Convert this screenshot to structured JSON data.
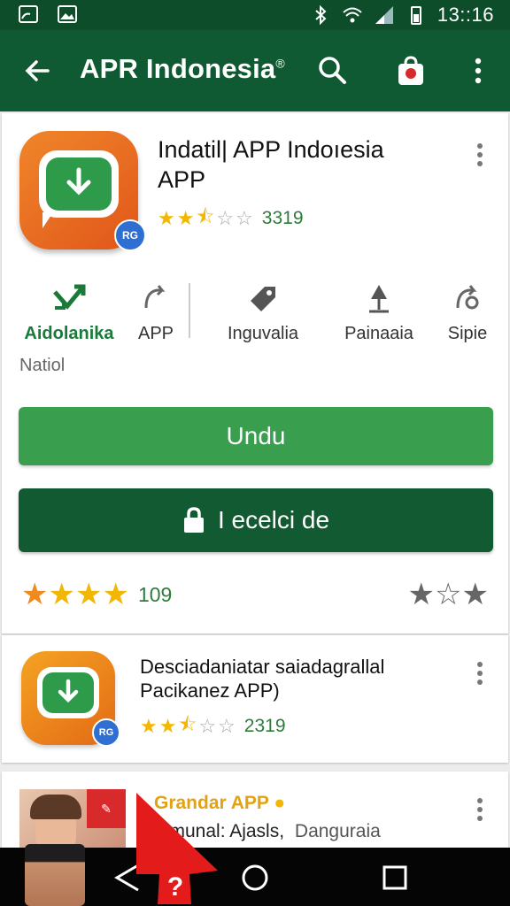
{
  "status_bar": {
    "time": "13::16"
  },
  "app_bar": {
    "title": "APR Indonesia",
    "title_mark": "®"
  },
  "featured": {
    "title_line1": "Indatil| APP Indoıesia",
    "title_line2": "APP",
    "badge": "RG",
    "rating": 2.5,
    "rating_count": "3319",
    "categories": [
      {
        "label": "Aidolanika",
        "icon": "download-arrows-icon",
        "active": true
      },
      {
        "label": "APP",
        "icon": "share-arrow-icon",
        "active": false
      },
      {
        "label": "Inguvalia",
        "icon": "tag-icon",
        "active": false
      },
      {
        "label": "Painaaia",
        "icon": "pin-icon",
        "active": false
      },
      {
        "label": "Sipie",
        "icon": "share-arrow-icon",
        "active": false
      }
    ],
    "sub_label": "Natiol",
    "install_label": "Undu",
    "secure_label": "I ecelci de",
    "bottom_rating": 4,
    "bottom_count": "109",
    "right_rating": 1
  },
  "item2": {
    "title_line1": "Desciadaniatar saiadagrallal",
    "title_line2": "Pacikanez APP)",
    "badge": "RG",
    "rating": 2.5,
    "rating_count": "2319"
  },
  "item3": {
    "title": "Grandar APP",
    "subtitle_a": "mmunal: Ajasls,",
    "subtitle_b": "Danguraia"
  },
  "colors": {
    "appbar": "#0f5a32",
    "statusbar": "#0d4d2a",
    "install": "#3a9e4f",
    "secure": "#125a32",
    "star": "#f2b705"
  }
}
